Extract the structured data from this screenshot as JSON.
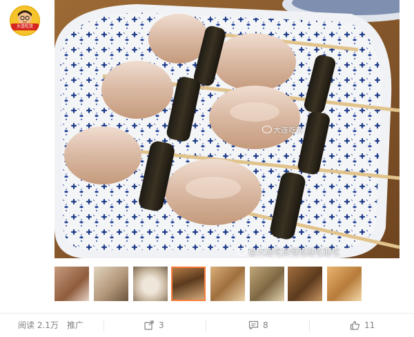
{
  "avatar": {
    "banner_text": "大连吃货"
  },
  "post": {
    "watermark_main": "大连吃货",
    "watermark_bottom": "@大连吃货嘎嘎逛吃逛吃"
  },
  "thumbnails": [
    {
      "name": "thumb-1",
      "color": "#b98a6a"
    },
    {
      "name": "thumb-2",
      "color": "#c9b49a"
    },
    {
      "name": "thumb-3",
      "color": "#d8cfc2"
    },
    {
      "name": "thumb-4",
      "color": "#a86d3e"
    },
    {
      "name": "thumb-5",
      "color": "#c89a62"
    },
    {
      "name": "thumb-6",
      "color": "#b79d6f"
    },
    {
      "name": "thumb-7",
      "color": "#9b6a3c"
    },
    {
      "name": "thumb-8",
      "color": "#d9a66a"
    }
  ],
  "footer": {
    "reads": "阅读 2.1万",
    "promote": "推广",
    "forward_count": "3",
    "comment_count": "8",
    "like_count": "11"
  },
  "colors": {
    "accent": "#fa7d3c",
    "text_muted": "#808080"
  }
}
